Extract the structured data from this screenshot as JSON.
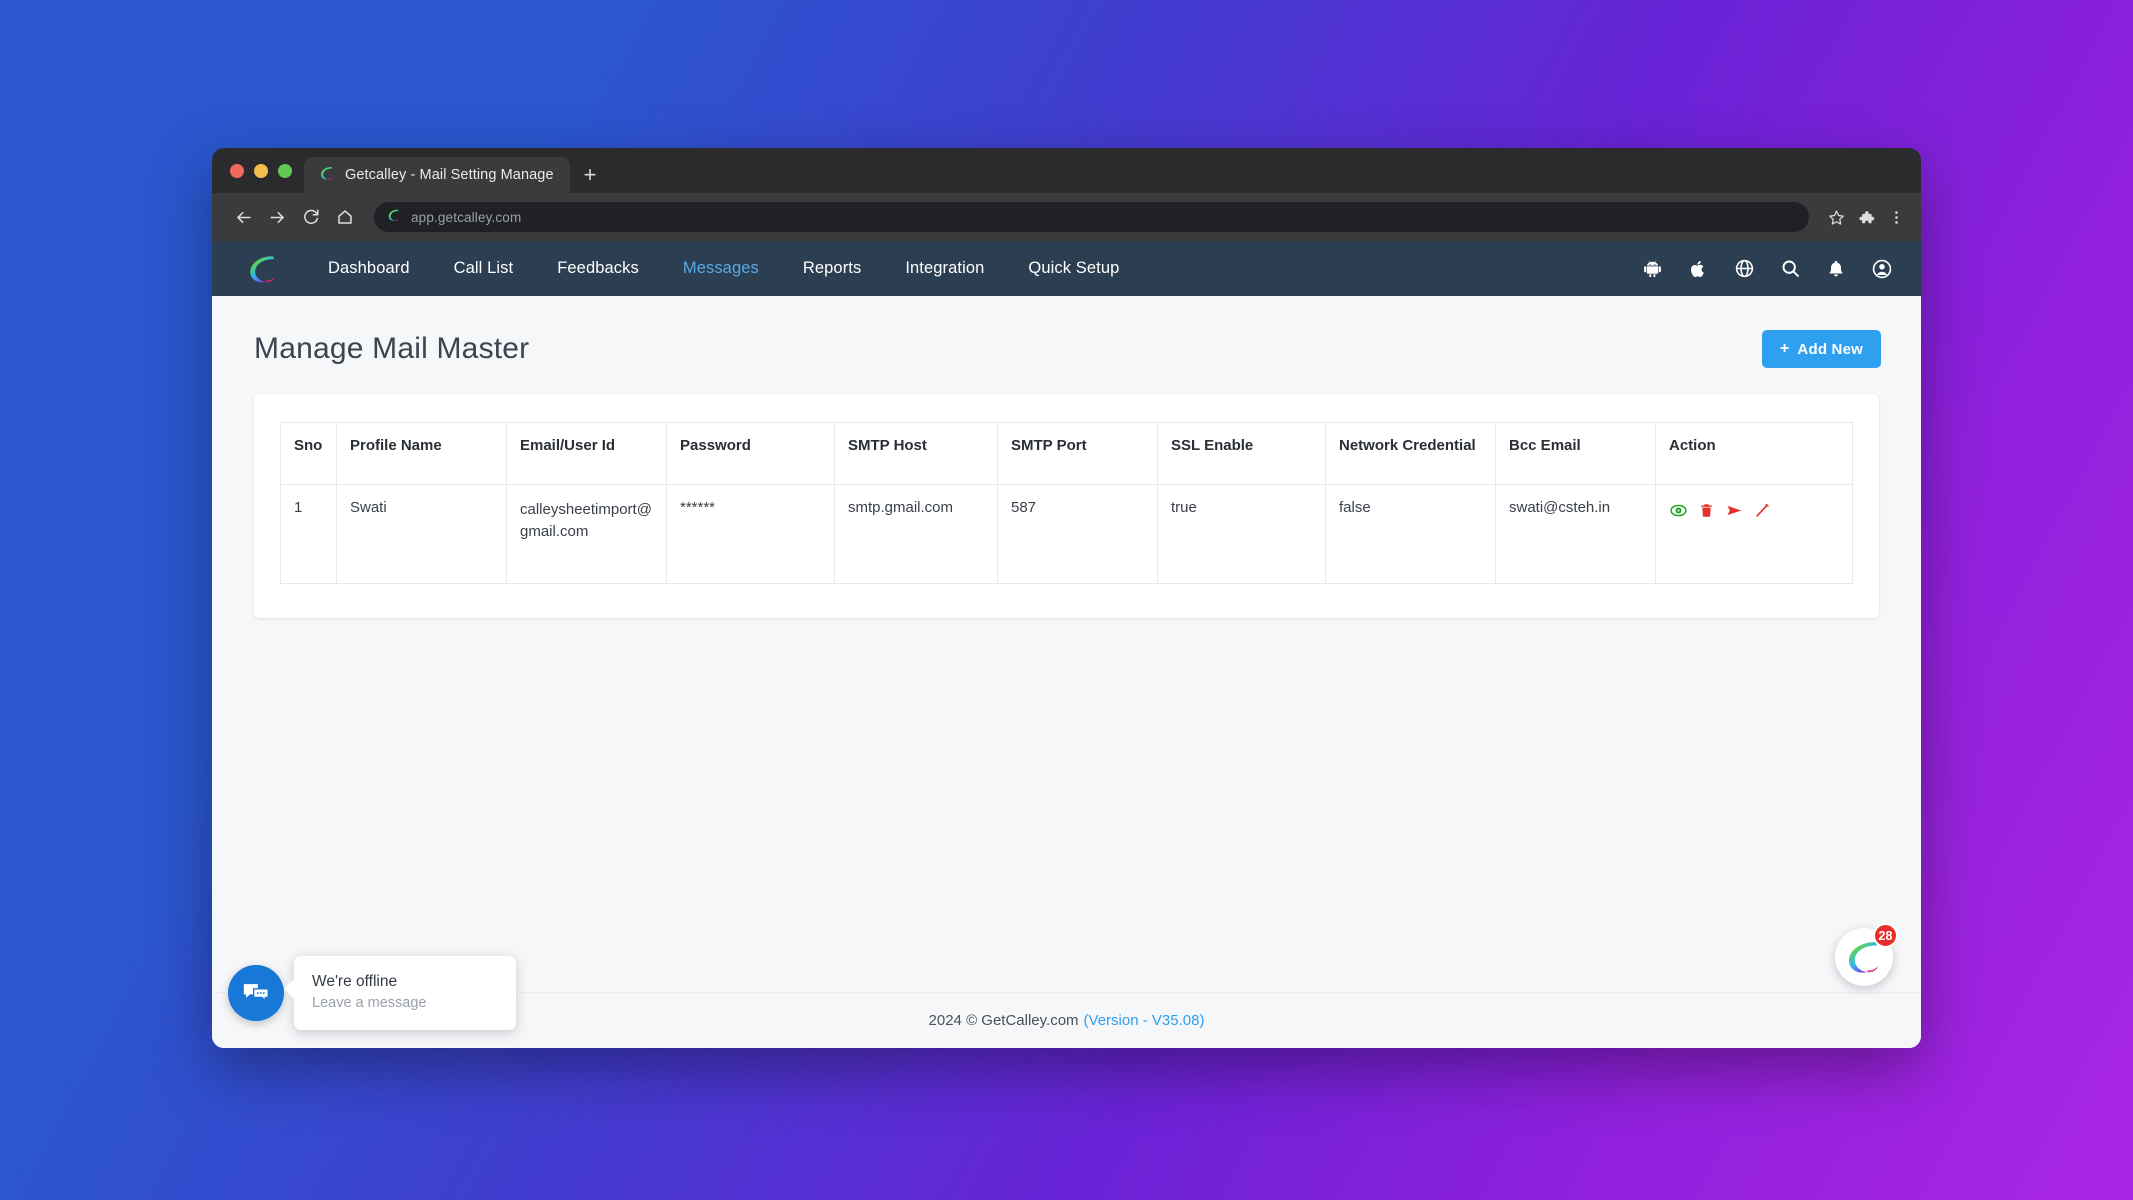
{
  "browser": {
    "tab_title": "Getcalley - Mail Setting Manage",
    "new_tab_label": "+",
    "url": "app.getcalley.com",
    "back_icon": "back-arrow-icon",
    "forward_icon": "forward-arrow-icon",
    "reload_icon": "reload-icon",
    "home_icon": "home-icon",
    "bookmark_icon": "star-icon",
    "extensions_icon": "puzzle-piece-icon",
    "menu_icon": "three-dots-menu-icon"
  },
  "navbar": {
    "brand": "calley-logo",
    "links": [
      {
        "label": "Dashboard",
        "active": false
      },
      {
        "label": "Call List",
        "active": false
      },
      {
        "label": "Feedbacks",
        "active": false
      },
      {
        "label": "Messages",
        "active": true
      },
      {
        "label": "Reports",
        "active": false
      },
      {
        "label": "Integration",
        "active": false
      },
      {
        "label": "Quick Setup",
        "active": false
      }
    ],
    "icons": [
      "android-icon",
      "apple-icon",
      "globe-icon",
      "search-icon",
      "bell-icon",
      "user-account-icon"
    ]
  },
  "page": {
    "title": "Manage Mail Master",
    "add_new_label": "Add New",
    "add_new_plus": "+"
  },
  "table": {
    "headers": [
      "Sno",
      "Profile Name",
      "Email/User Id",
      "Password",
      "SMTP Host",
      "SMTP Port",
      "SSL Enable",
      "Network Credential",
      "Bcc Email",
      "Action"
    ],
    "rows": [
      {
        "sno": "1",
        "profile_name": "Swati",
        "email": "calleysheetimport@gmail.com",
        "password": "******",
        "smtp_host": "smtp.gmail.com",
        "smtp_port": "587",
        "ssl_enable": "true",
        "network_credential": "false",
        "bcc_email": "swati@csteh.in",
        "actions": [
          "view-eye-icon",
          "delete-trash-icon",
          "send-paperplane-icon",
          "edit-pencil-icon"
        ]
      }
    ]
  },
  "footer": {
    "copyright": "2024 © GetCalley.com",
    "version": "(Version - V35.08)"
  },
  "chat": {
    "icon": "chat-bubbles-icon",
    "title": "We're offline",
    "subtitle": "Leave a message"
  },
  "launcher": {
    "icon": "calley-logo-icon",
    "badge": "28"
  },
  "colors": {
    "accent_blue": "#2f9ff0",
    "navbar_bg": "#2c3e52",
    "nav_active": "#5aa9e6",
    "action_green": "#1aa41a",
    "action_red": "#e8302a",
    "badge_red": "#e8302a",
    "page_bg": "#f6f7f9",
    "bg_gradient_start": "#2a57cf",
    "bg_gradient_end": "#a926e4"
  }
}
